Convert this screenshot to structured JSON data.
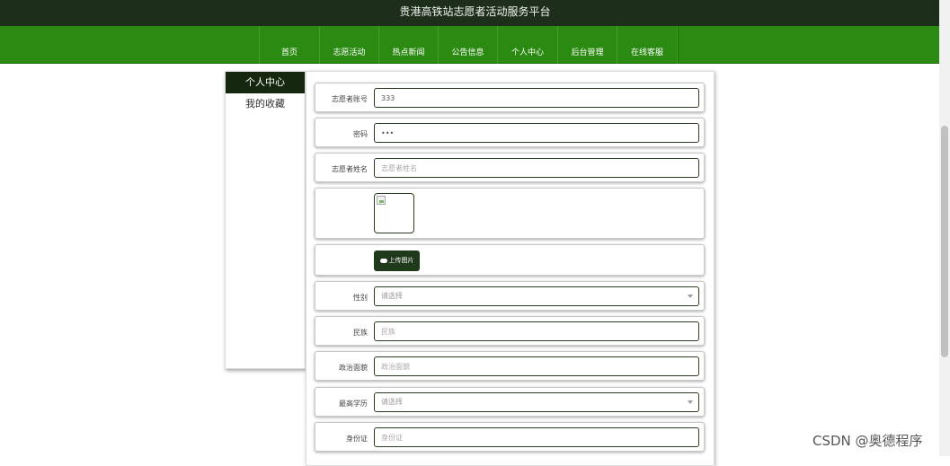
{
  "header": {
    "title": "贵港高铁站志愿者活动服务平台"
  },
  "nav": [
    "首页",
    "志愿活动",
    "热点新闻",
    "公告信息",
    "个人中心",
    "后台管理",
    "在线客服"
  ],
  "sidebar": {
    "items": [
      "个人中心",
      "我的收藏"
    ]
  },
  "form": {
    "account": {
      "label": "志愿者账号",
      "value": "333"
    },
    "password": {
      "label": "密码",
      "value": "•••"
    },
    "name": {
      "label": "志愿者姓名",
      "placeholder": "志愿者姓名"
    },
    "upload_label": "上传图片",
    "gender": {
      "label": "性别",
      "placeholder": "请选择"
    },
    "ethnicity": {
      "label": "民族",
      "placeholder": "民族"
    },
    "political": {
      "label": "政治面貌",
      "placeholder": "政治面貌"
    },
    "education": {
      "label": "最高学历",
      "placeholder": "请选择"
    },
    "idcard": {
      "label": "身份证",
      "placeholder": "身份证"
    }
  },
  "watermark": "CSDN @奥德程序",
  "icons": {
    "upload": "cloud-upload-icon",
    "dropdown": "chevron-down-icon",
    "image": "broken-image-icon"
  },
  "colors": {
    "topbar": "#1d2f1a",
    "nav": "#2b8a11",
    "active_side": "#15280f",
    "button": "#1f3a1b"
  }
}
